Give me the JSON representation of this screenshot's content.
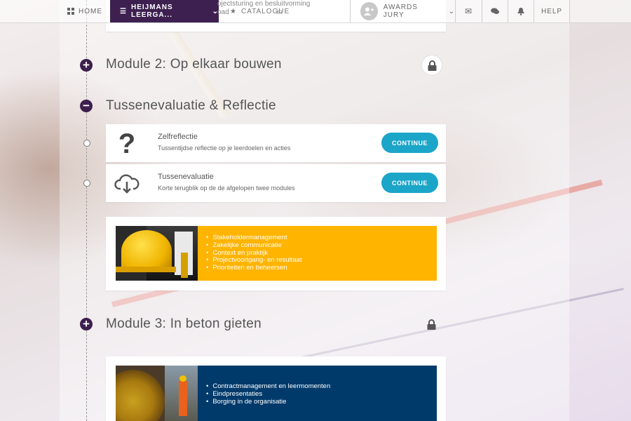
{
  "topbar": {
    "home": "HOME",
    "course": "HEIJMANS LEERGA...",
    "catalogue": "CATALOGUE",
    "user": "AWARDS JURY",
    "help": "HELP"
  },
  "overlay_text": [
    "ojectsturing en besluitvorming",
    "oad",
    "in"
  ],
  "modules": [
    {
      "title": "Module 2: Op elkaar bouwen",
      "toggle": "+"
    },
    {
      "title": "Tussenevaluatie & Reflectie",
      "toggle": "−"
    },
    {
      "title": "Module 3: In beton gieten",
      "toggle": "+"
    }
  ],
  "lessons": [
    {
      "icon": "question-mark-icon",
      "title": "Zelfreflectie",
      "subtitle": "Tussentijdse reflectie op je leerdoelen en acties",
      "action": "CONTINUE"
    },
    {
      "icon": "cloud-download-icon",
      "title": "Tussenevaluatie",
      "subtitle": "Korte terugblik op de de afgelopen twee modules",
      "action": "CONTINUE"
    }
  ],
  "banners": [
    {
      "color": "#ffb400",
      "items": [
        "Stakeholdermanagement",
        "Zakelijke communicatie",
        "Context en praktijk",
        "Projectvoortgang- en resultaat",
        "Prioriteiten en beheersen"
      ]
    },
    {
      "color": "#003a6b",
      "items": [
        "Contractmanagement en leermomenten",
        "Eindpresentaties",
        "Borging in de organisatie"
      ]
    }
  ],
  "colors": {
    "accent": "#3d2050",
    "button": "#1ba5c9"
  }
}
